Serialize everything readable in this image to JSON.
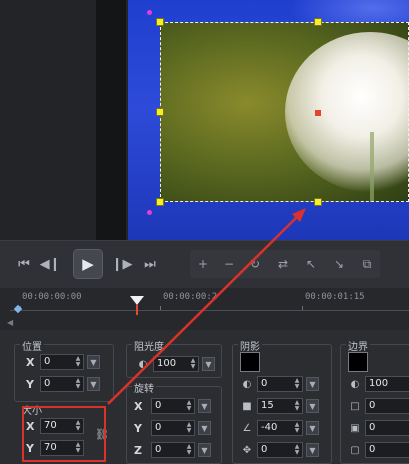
{
  "timeline": {
    "times": [
      "00:00:00:00",
      "00:00:00:2",
      "00:00:01:15"
    ]
  },
  "transport": {
    "icons": [
      "skip-to-start-icon",
      "prev-frame-icon",
      "play-icon",
      "next-frame-icon",
      "skip-to-end-icon"
    ],
    "tools": [
      "add-keyframe-icon",
      "remove-keyframe-icon",
      "reverse-icon",
      "swap-icon",
      "previous-keyframe-icon",
      "next-keyframe-icon",
      "duplicate-icon"
    ]
  },
  "position": {
    "title": "位置",
    "x_label": "X",
    "x_value": "0",
    "y_label": "Y",
    "y_value": "0"
  },
  "size": {
    "title": "大小",
    "x_label": "X",
    "x_value": "70",
    "y_label": "Y",
    "y_value": "70"
  },
  "opacity": {
    "title": "阻光度",
    "value": "100"
  },
  "rotation": {
    "title": "旋转",
    "x_label": "X",
    "x_value": "0",
    "y_label": "Y",
    "y_value": "0",
    "z_label": "Z",
    "z_value": "0"
  },
  "shadow": {
    "title": "阴影",
    "color": "#000000",
    "values": [
      "0",
      "15",
      "-40",
      "0"
    ]
  },
  "border": {
    "title": "边界",
    "color": "#000000",
    "values": [
      "100",
      "0",
      "0",
      "0"
    ]
  },
  "colors": {
    "annotation_red": "#d9322b",
    "handle_yellow": "#f6ef2a",
    "canvas_blue": "#2d4bd8"
  }
}
